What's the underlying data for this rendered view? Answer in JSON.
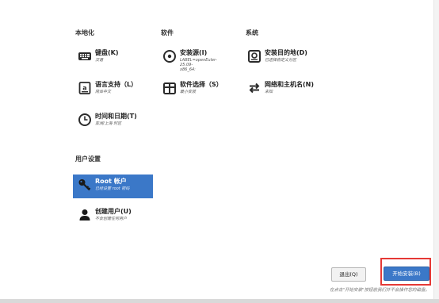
{
  "sections": {
    "localization": "本地化",
    "software": "软件",
    "system": "系统",
    "user_settings": "用户设置"
  },
  "spokes": {
    "keyboard": {
      "title": "键盘(K)",
      "status": "汉语",
      "icon": "keyboard-icon"
    },
    "language": {
      "title": "语言支持（L）",
      "status": "简体中文",
      "icon": "language-icon"
    },
    "datetime": {
      "title": "时间和日期(T)",
      "status": "亚洲/上海 时区",
      "icon": "clock-icon"
    },
    "source": {
      "title": "安装源(I)",
      "status": "LABEL=openEuler-25.09-\nx86_64:",
      "icon": "disc-icon"
    },
    "software_selection": {
      "title": "软件选择（S）",
      "status": "最小安装",
      "icon": "package-icon"
    },
    "destination": {
      "title": "安装目的地(D)",
      "status": "已选择自定义分区",
      "icon": "hard-drive-icon"
    },
    "network": {
      "title": "网络和主机名(N)",
      "status": "未知",
      "icon": "network-arrows-icon"
    },
    "root": {
      "title": "Root 帐户",
      "status": "已经设置 root 密码",
      "icon": "key-icon"
    },
    "user": {
      "title": "创建用户(U)",
      "status": "不会创建任何用户",
      "icon": "user-icon"
    }
  },
  "buttons": {
    "quit": "退出(Q)",
    "begin": "开始安装(B)"
  },
  "warning": "在点击\"开始安装\"按钮前我们并不会操作您的磁盘。",
  "colors": {
    "accent": "#3b78c8",
    "highlight_border": "#e53935"
  }
}
